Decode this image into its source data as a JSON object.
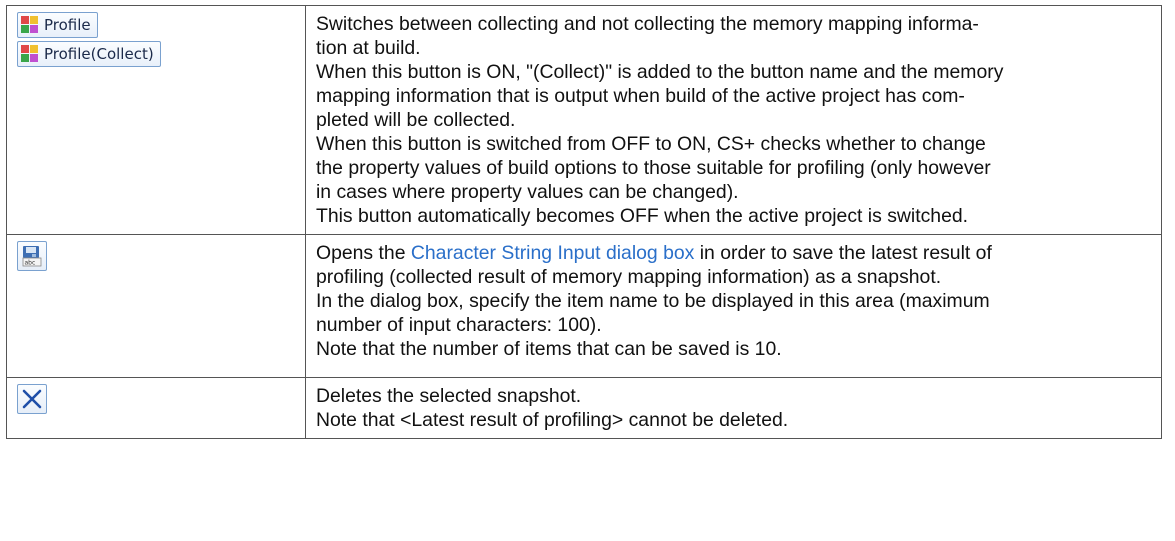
{
  "rows": [
    {
      "buttons": [
        "Profile",
        "Profile(Collect)"
      ],
      "icon": "profile-icon",
      "description": [
        "Switches between collecting and not collecting the memory mapping informa-",
        "tion at build.",
        "When this button is ON, \"(Collect)\" is added to the button name and the memory",
        "mapping information that is output when build of the active project has com-",
        "pleted will be collected.",
        "When this button is switched from OFF to ON, CS+ checks whether to change",
        "the property values of build options to those suitable for profiling (only however",
        "in cases where property values can be changed).",
        "This button automatically becomes OFF when the active project is switched."
      ]
    },
    {
      "icon": "save-snapshot-icon",
      "description_pre": "Opens the ",
      "description_link": "Character String Input dialog box",
      "description_post": " in order to save the latest result of",
      "description": [
        "profiling (collected result of memory mapping information) as a snapshot.",
        "In the dialog box, specify the item name to be displayed in this area (maximum",
        "number of input characters: 100).",
        "Note that the number of items that can be saved is 10."
      ]
    },
    {
      "icon": "delete-icon",
      "description": [
        "Deletes the selected snapshot.",
        "Note that <Latest result of profiling> cannot be deleted."
      ]
    }
  ],
  "colors": {
    "link": "#2a6fc9",
    "border": "#555555",
    "button_border": "#7aa1cf"
  }
}
